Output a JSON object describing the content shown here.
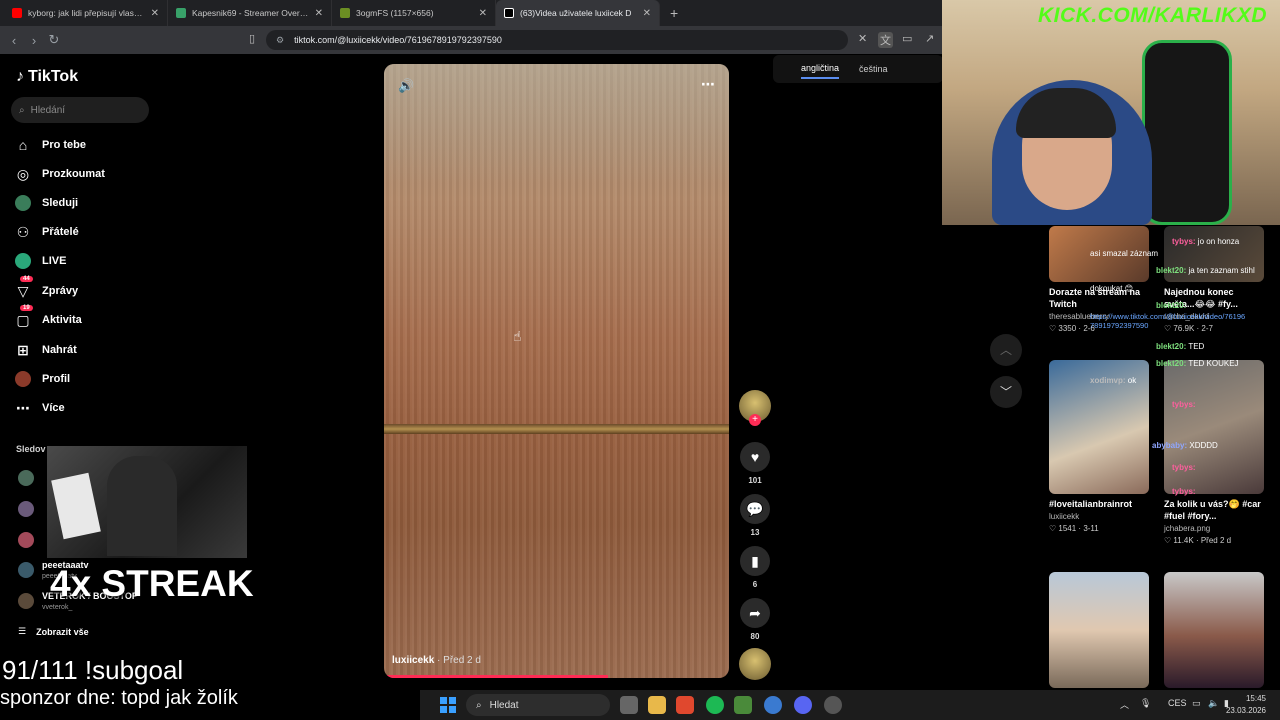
{
  "browser": {
    "tabs": [
      {
        "title": "kyborg: jak lidi přepisují vlastní tělo a",
        "color": "#ff0000",
        "active": false
      },
      {
        "title": "Kapesnik69 - Streamer Overview & S",
        "color": "#38a169",
        "active": false
      },
      {
        "title": "3ogmFS (1157×656)",
        "color": "#6b8e23",
        "active": false
      },
      {
        "title": "(63)Videa uživatele luxiicek D",
        "color": "#ffffff",
        "active": true
      }
    ],
    "new_tab": "+",
    "url": "tiktok.com/@luxiicekk/video/7619678919792397590"
  },
  "tiktok": {
    "brand": "TikTok",
    "search_placeholder": "Hledání",
    "nav": [
      {
        "label": "Pro tebe",
        "icon": "home-icon"
      },
      {
        "label": "Prozkoumat",
        "icon": "compass-icon"
      },
      {
        "label": "Sleduji",
        "icon": "following-icon"
      },
      {
        "label": "Přátelé",
        "icon": "friends-icon"
      },
      {
        "label": "LIVE",
        "icon": "live-icon"
      },
      {
        "label": "Zprávy",
        "icon": "message-icon",
        "badge": "44"
      },
      {
        "label": "Aktivita",
        "icon": "activity-icon",
        "badge": "19"
      },
      {
        "label": "Nahrát",
        "icon": "upload-icon"
      },
      {
        "label": "Profil",
        "icon": "profile-icon"
      },
      {
        "label": "Více",
        "icon": "more-icon"
      }
    ],
    "following_header": "Sledov",
    "following": [
      {
        "name": "peeetaaatv",
        "handle": "peeetaaatv"
      },
      {
        "name": "VETEROK / BOOSTOP",
        "handle": "vveterok_"
      }
    ],
    "show_all": "Zobrazit vše"
  },
  "video": {
    "author": "luxiicekk",
    "date": " · Před 2 d",
    "progress": 0.65,
    "likes": "101",
    "comments": "13",
    "saves": "6",
    "shares": "80"
  },
  "languages": {
    "active": "angličtina",
    "other": "čeština"
  },
  "grid": [
    {
      "title": "Dorazte na stream na Twitch",
      "user": "theresablueberry",
      "likes": "3350",
      "date": "2-6"
    },
    {
      "title": "Najednou konec světa...😂😂 #fy...",
      "user": "vacha_david",
      "likes": "76.9K",
      "date": "2-7"
    },
    {
      "title": "#loveitalianbrainrot",
      "user": "luxiicekk",
      "likes": "1541",
      "date": "3-11"
    },
    {
      "title": "Za kolik u vás?🤭 #car #fuel #fory...",
      "user": "jchabera.png",
      "likes": "11.4K",
      "date": "Před 2 d"
    }
  ],
  "chat": [
    {
      "user": "tybys:",
      "text": "jo on honza",
      "color": "#ff5f9e"
    },
    {
      "user": "",
      "text": "asi smazal záznam",
      "color": "#ffffff"
    },
    {
      "user": "blekt20:",
      "text": "ja ten zaznam stihl",
      "color": "#7ee07e"
    },
    {
      "user": "",
      "text": "dokoukat 😊",
      "color": "#ffffff"
    },
    {
      "user": "blekt20:",
      "text": "",
      "color": "#7ee07e"
    },
    {
      "user": "blekt20:",
      "text": "TED",
      "color": "#7ee07e"
    },
    {
      "user": "blekt20:",
      "text": "TED KOUKEJ",
      "color": "#7ee07e"
    },
    {
      "user": "xodimvp:",
      "text": "ok",
      "color": "#bbbbbb"
    },
    {
      "user": "tybys:",
      "text": "",
      "color": "#ff5f9e"
    },
    {
      "user": "abybaby:",
      "text": "XDDDD",
      "color": "#8fa6ff"
    },
    {
      "user": "tybys:",
      "text": "",
      "color": "#ff5f9e"
    },
    {
      "user": "tybys:",
      "text": "",
      "color": "#ff5f9e"
    }
  ],
  "chat_link": "https://www.tiktok.com/@luxiicekk/video/76196 78919792397590",
  "stream": {
    "kick": "KICK.COM/KARLIKXD",
    "streak": "4x STREAK",
    "subgoal": "91/111 !subgoal",
    "sponsor": "sponzor dne: topd jak žolík"
  },
  "taskbar": {
    "search": "Hledat",
    "lang": "CES",
    "time": "15:45",
    "date": "23.03.2026"
  }
}
